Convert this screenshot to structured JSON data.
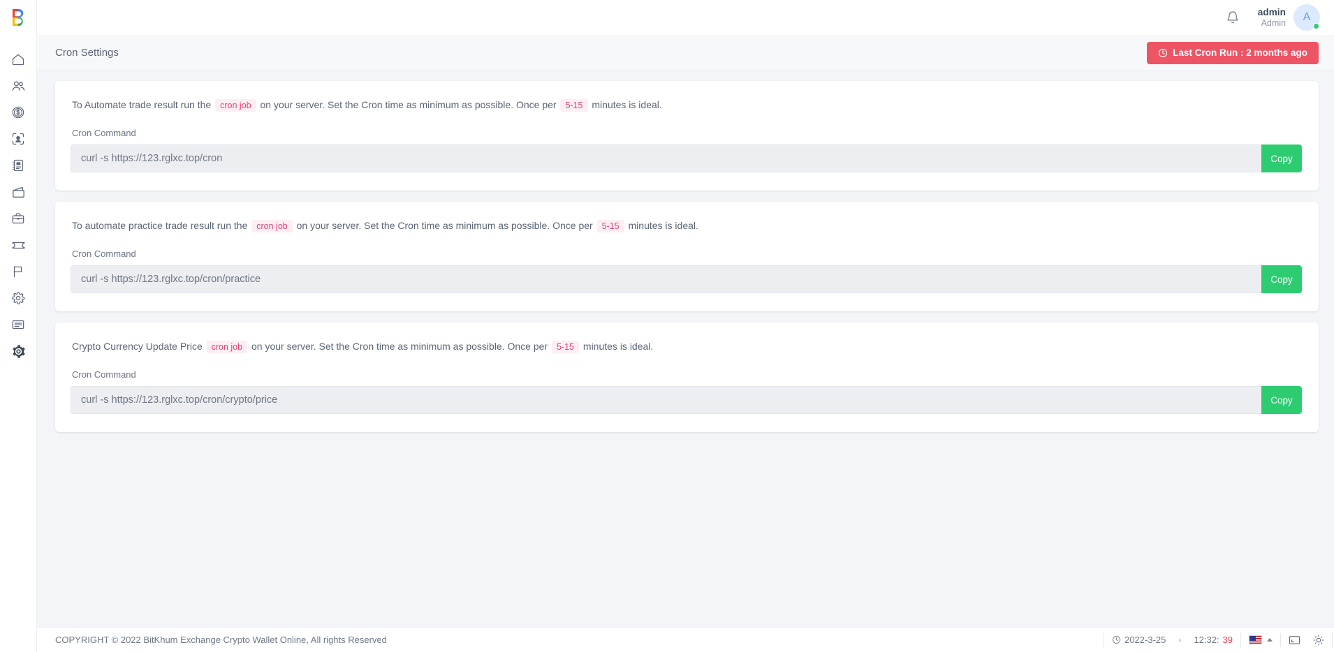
{
  "app": {
    "logo_icon": "bitkhum-b-logo",
    "logo_letter": "B"
  },
  "sidebar": {
    "items": [
      {
        "name": "dashboard",
        "icon": "home-icon",
        "active": false
      },
      {
        "name": "users",
        "icon": "users-icon",
        "active": false
      },
      {
        "name": "payments",
        "icon": "dollar-coin-icon",
        "active": false
      },
      {
        "name": "kyc",
        "icon": "id-scan-icon",
        "active": false
      },
      {
        "name": "reports",
        "icon": "notebook-icon",
        "active": false
      },
      {
        "name": "wallet",
        "icon": "wallet-icon",
        "active": false
      },
      {
        "name": "trades",
        "icon": "briefcase-icon",
        "active": false
      },
      {
        "name": "tickets",
        "icon": "ticket-icon",
        "active": false
      },
      {
        "name": "flags",
        "icon": "flag-icon",
        "active": false
      },
      {
        "name": "preferences",
        "icon": "gear-outline-icon",
        "active": false
      },
      {
        "name": "pages",
        "icon": "document-icon",
        "active": false
      },
      {
        "name": "settings",
        "icon": "gear-solid-icon",
        "active": true
      }
    ]
  },
  "header": {
    "bell_icon": "notification-bell-icon",
    "user_name": "admin",
    "user_role": "Admin",
    "avatar_letter": "A",
    "status": "online"
  },
  "page": {
    "title": "Cron Settings",
    "cron_run_button": {
      "label": "Last Cron Run : 2 months ago",
      "icon": "clock-icon",
      "color": "#ed5565"
    }
  },
  "cards": [
    {
      "desc_part1": "To Automate trade result run the",
      "chip1": "cron job",
      "desc_part2": "on your server. Set the Cron time as minimum as possible. Once per",
      "chip2": "5-15",
      "desc_part3": "minutes is ideal.",
      "field_label": "Cron Command",
      "command": "curl -s https://123.rglxc.top/cron",
      "copy_label": "Copy"
    },
    {
      "desc_part1": "To automate practice trade result run the",
      "chip1": "cron job",
      "desc_part2": "on your server. Set the Cron time as minimum as possible. Once per",
      "chip2": "5-15",
      "desc_part3": "minutes is ideal.",
      "field_label": "Cron Command",
      "command": "curl -s https://123.rglxc.top/cron/practice",
      "copy_label": "Copy"
    },
    {
      "desc_part1": "Crypto Currency Update Price",
      "chip1": "cron job",
      "desc_part2": "on your server. Set the Cron time as minimum as possible. Once per",
      "chip2": "5-15",
      "desc_part3": "minutes is ideal.",
      "field_label": "Cron Command",
      "command": "curl -s https://123.rglxc.top/cron/crypto/price",
      "copy_label": "Copy"
    }
  ],
  "footer": {
    "copyright": "COPYRIGHT © 2022 BitKhum Exchange Crypto Wallet Online, All rights Reserved",
    "tray": {
      "date_icon": "clock-icon",
      "date": "2022-3-25",
      "chevron": "›",
      "time_main": "12:32:",
      "time_seconds": "39",
      "language_icon": "us-flag-icon",
      "expand_icon": "caret-up-icon",
      "screen_icon": "screen-icon",
      "brightness_icon": "brightness-icon"
    }
  },
  "colors": {
    "accent_green": "#2ecc71",
    "accent_red": "#ed5565",
    "chip_bg": "#fdeef3",
    "chip_text": "#e8417c"
  }
}
